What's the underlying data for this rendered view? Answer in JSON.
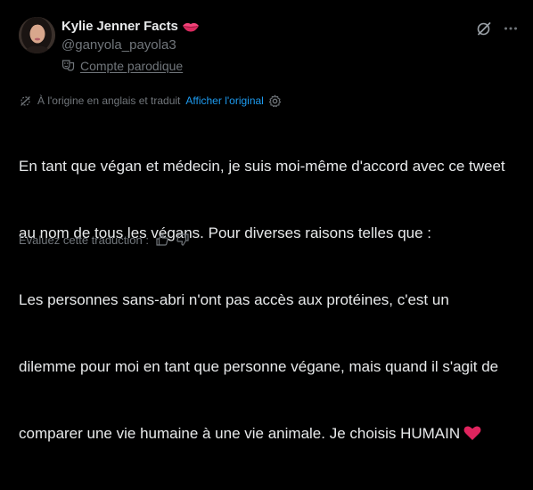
{
  "author": {
    "display_name": "Kylie Jenner Facts",
    "name_emoji": "lips-icon",
    "handle": "@ganyola_payola3",
    "parody_label": "Compte parodique",
    "parody_icon": "theater-masks-icon"
  },
  "actions": {
    "grok_icon": "grok-icon",
    "more_icon": "more-icon"
  },
  "translation": {
    "note": "À l'origine en anglais et traduit",
    "show_original": "Afficher l'original",
    "settings_icon": "gear-icon"
  },
  "tweet": {
    "lines": [
      "En tant que végan et médecin, je suis moi-même d'accord avec ce tweet",
      "au nom de tous les végans. Pour diverses raisons telles que :",
      "Les personnes sans-abri n'ont pas accès aux protéines, c'est un",
      "dilemme pour moi en tant que personne végane, mais quand il s'agit de",
      "comparer une vie humaine à une vie animale. Je choisis HUMAIN"
    ],
    "trailing_emoji": "red-heart-icon"
  },
  "rating": {
    "label": "Évaluez cette traduction :",
    "thumbs_up_icon": "thumbs-up-icon",
    "thumbs_down_icon": "thumbs-down-icon"
  },
  "colors": {
    "background": "#000000",
    "text_primary": "#e7e9ea",
    "text_secondary": "#71767b",
    "link": "#1d9bf0",
    "heart": "#e0245e",
    "lips": "#f4437a"
  }
}
